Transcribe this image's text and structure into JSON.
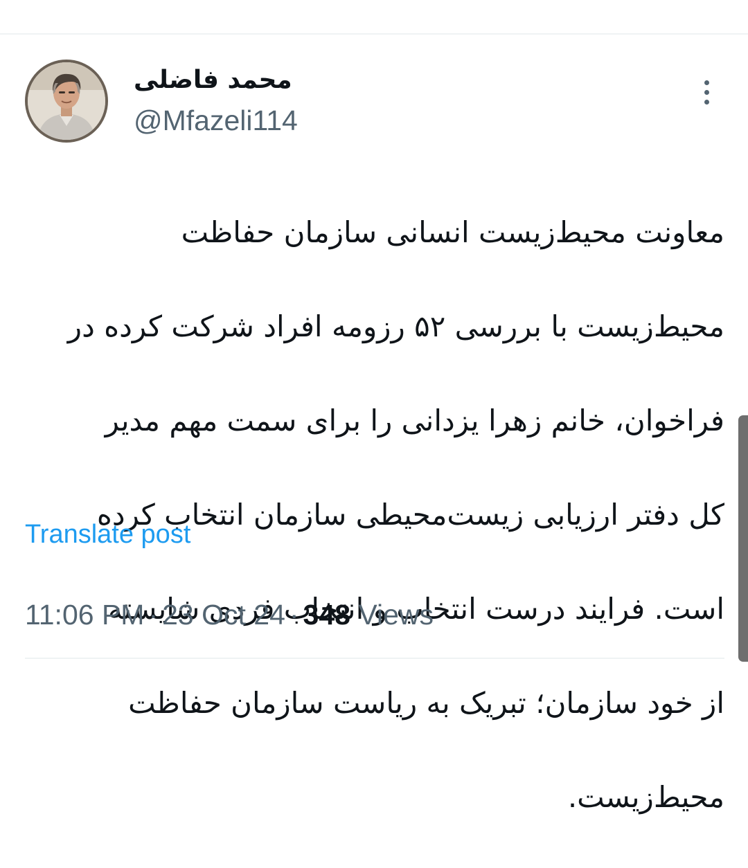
{
  "author": {
    "display_name": "محمد فاضلی",
    "handle": "@Mfazeli114",
    "avatar_icon": "profile-photo"
  },
  "more_icon": "vertical-ellipsis-icon",
  "tweet": {
    "lines": [
      "معاونت محیط‌زیست انسانی سازمان حفاظت",
      "محیط‌زیست با بررسی ۵۲ رزومه افراد شرکت کرده در",
      "فراخوان، خانم زهرا یزدانی را برای سمت مهم مدیر",
      "کل دفتر ارزیابی زیست‌محیطی سازمان انتخاب کرده",
      "است. فرایند درست انتخاب و انتخاب فردی شایسته",
      "از خود سازمان؛ تبریک به ریاست سازمان حفاظت",
      "محیط‌زیست."
    ],
    "translate_label": "Translate post"
  },
  "meta": {
    "time": "11:06 PM",
    "date": "23 Oct 24",
    "separator": "·",
    "views_count": "348",
    "views_label": "Views"
  },
  "colors": {
    "link": "#1d9bf0",
    "secondary_text": "#536471",
    "primary_text": "#0f1419",
    "divider": "#eff3f4"
  }
}
